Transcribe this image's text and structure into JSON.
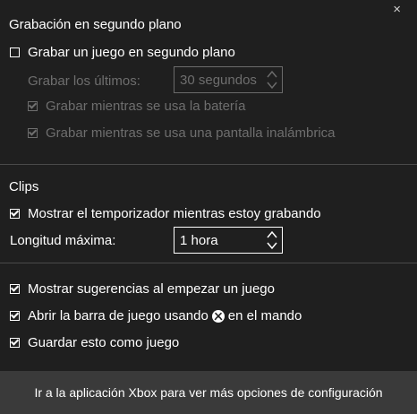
{
  "close_icon": "×",
  "background": {
    "title": "Grabación en segundo plano",
    "record_in_background": {
      "label": "Grabar un juego en segundo plano",
      "checked": false
    },
    "record_last": {
      "label": "Grabar los últimos:",
      "value": "30 segundos",
      "enabled": false
    },
    "record_on_battery": {
      "label": "Grabar mientras se usa la batería",
      "checked": true,
      "enabled": false
    },
    "record_wireless_display": {
      "label": "Grabar mientras se usa una pantalla inalámbrica",
      "checked": true,
      "enabled": false
    }
  },
  "clips": {
    "title": "Clips",
    "show_timer": {
      "label": "Mostrar el temporizador mientras estoy grabando",
      "checked": true
    },
    "max_length": {
      "label": "Longitud máxima:",
      "value": "1 hora"
    }
  },
  "options": {
    "show_tips": {
      "label": "Mostrar sugerencias al empezar un juego",
      "checked": true
    },
    "open_game_bar_prefix": "Abrir la barra de juego usando",
    "open_game_bar_suffix": "en el mando",
    "open_game_bar_checked": true,
    "remember_game": {
      "label": "Guardar esto como juego",
      "checked": true
    }
  },
  "footer": {
    "label": "Ir a la aplicación Xbox para ver más opciones de configuración"
  }
}
